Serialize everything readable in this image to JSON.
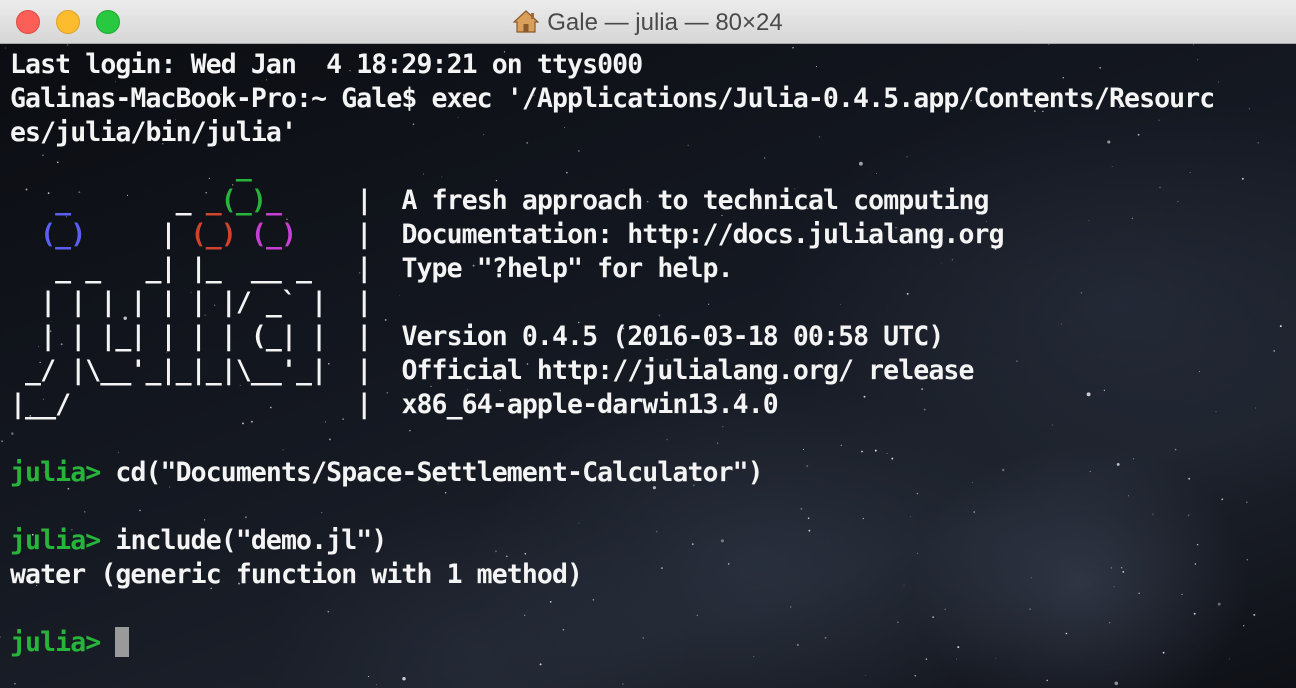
{
  "window": {
    "title": "Gale — julia — 80×24",
    "title_icon": "home-icon",
    "buttons": {
      "close": "close-button",
      "minimize": "minimize-button",
      "zoom": "zoom-button"
    }
  },
  "colors": {
    "logo_blue": "#5b5ff0",
    "logo_red": "#d1432d",
    "logo_green": "#27b43a",
    "logo_purple": "#c93fd6",
    "prompt": "#27b43a",
    "text": "#f4f4f4",
    "cursor": "#9a9a9a"
  },
  "terminal": {
    "last_login": "Last login: Wed Jan  4 18:29:21 on ttys000",
    "exec_line_1": "Galinas-MacBook-Pro:~ Gale$ exec '/Applications/Julia-0.4.5.app/Contents/Resourc",
    "exec_line_2": "es/julia/bin/julia'",
    "banner": {
      "logo": [
        {
          "segments": [
            {
              "t": "               ",
              "c": ""
            },
            {
              "t": "_",
              "c": "green"
            },
            {
              "t": "       ",
              "c": ""
            }
          ]
        },
        {
          "segments": [
            {
              "t": "   ",
              "c": ""
            },
            {
              "t": "_",
              "c": "blue"
            },
            {
              "t": "       ",
              "c": ""
            },
            {
              "t": "_ ",
              "c": ""
            },
            {
              "t": "_",
              "c": "red"
            },
            {
              "t": "(_)",
              "c": "green"
            },
            {
              "t": "_",
              "c": "purple"
            },
            {
              "t": "     ",
              "c": ""
            }
          ]
        },
        {
          "segments": [
            {
              "t": "  ",
              "c": ""
            },
            {
              "t": "(_)",
              "c": "blue"
            },
            {
              "t": "     | ",
              "c": ""
            },
            {
              "t": "(_)",
              "c": "red"
            },
            {
              "t": " ",
              "c": ""
            },
            {
              "t": "(_)",
              "c": "purple"
            },
            {
              "t": "    ",
              "c": ""
            }
          ]
        },
        {
          "segments": [
            {
              "t": "   _ _   _| |_  __ _   ",
              "c": ""
            }
          ]
        },
        {
          "segments": [
            {
              "t": "  | | | | | | |/ _` |  ",
              "c": ""
            }
          ]
        },
        {
          "segments": [
            {
              "t": "  | | |_| | | | (_| |  ",
              "c": ""
            }
          ]
        },
        {
          "segments": [
            {
              "t": " _/ |\\__'_|_|_|\\__'_|  ",
              "c": ""
            }
          ]
        },
        {
          "segments": [
            {
              "t": "|__/                   ",
              "c": ""
            }
          ]
        }
      ],
      "info": [
        "",
        "A fresh approach to technical computing",
        "Documentation: http://docs.julialang.org",
        "Type \"?help\" for help.",
        "",
        "Version 0.4.5 (2016-03-18 00:58 UTC)",
        "Official http://julialang.org/ release",
        "x86_64-apple-darwin13.4.0"
      ]
    },
    "prompt": "julia> ",
    "commands": [
      {
        "input": "cd(\"Documents/Space-Settlement-Calculator\")",
        "output": ""
      },
      {
        "input": "include(\"demo.jl\")",
        "output": "water (generic function with 1 method)"
      }
    ]
  }
}
